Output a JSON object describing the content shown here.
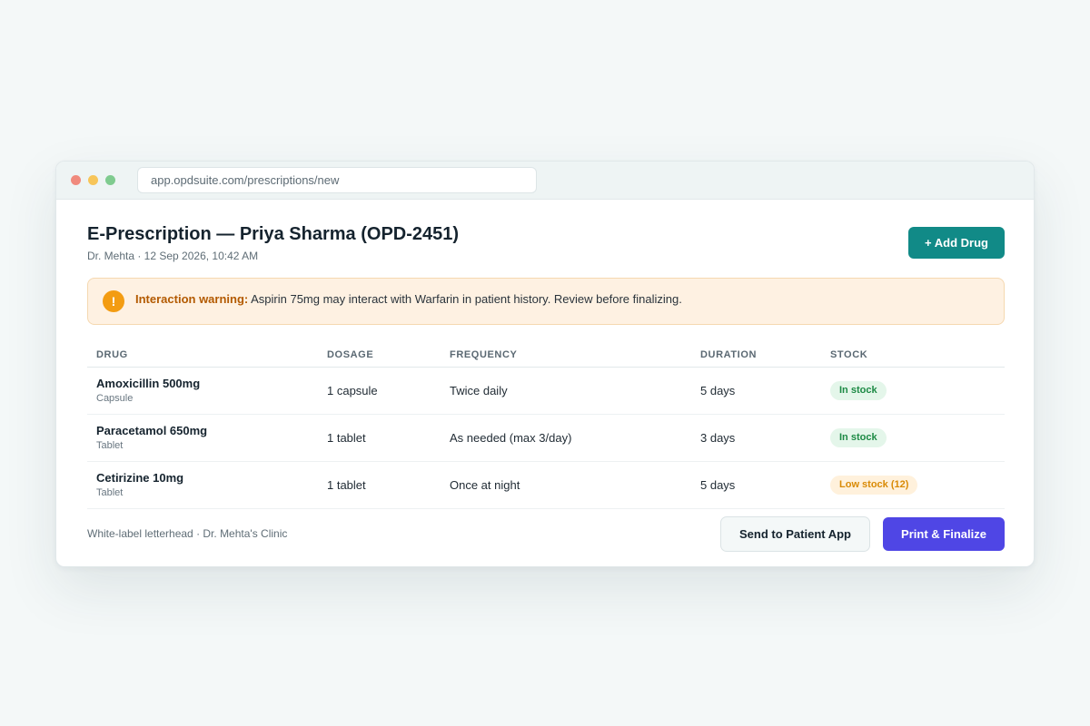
{
  "browser": {
    "url": "app.opdsuite.com/prescriptions/new"
  },
  "header": {
    "title": "E-Prescription — Priya Sharma (OPD-2451)",
    "subtitle": "Dr. Mehta · 12 Sep 2026, 10:42 AM",
    "add_drug_label": "+ Add Drug"
  },
  "warning": {
    "icon": "!",
    "label": "Interaction warning:",
    "message": " Aspirin 75mg may interact with Warfarin in patient history. Review before finalizing."
  },
  "table": {
    "columns": [
      "DRUG",
      "DOSAGE",
      "FREQUENCY",
      "DURATION",
      "STOCK"
    ],
    "rows": [
      {
        "drug": "Amoxicillin 500mg",
        "form": "Capsule",
        "dosage": "1 capsule",
        "frequency": "Twice daily",
        "duration": "5 days",
        "stock": "In stock",
        "stock_status": "ok"
      },
      {
        "drug": "Paracetamol 650mg",
        "form": "Tablet",
        "dosage": "1 tablet",
        "frequency": "As needed (max 3/day)",
        "duration": "3 days",
        "stock": "In stock",
        "stock_status": "ok"
      },
      {
        "drug": "Cetirizine 10mg",
        "form": "Tablet",
        "dosage": "1 tablet",
        "frequency": "Once at night",
        "duration": "5 days",
        "stock": "Low stock (12)",
        "stock_status": "low"
      }
    ]
  },
  "footer": {
    "note": "White-label letterhead · Dr. Mehta's Clinic",
    "send_label": "Send to Patient App",
    "print_label": "Print & Finalize"
  },
  "colors": {
    "accent_teal": "#118a87",
    "primary_indigo": "#4f46e5",
    "warning_orange": "#f39c12",
    "stock_ok": "#1d8a45",
    "stock_low": "#d98a05"
  }
}
